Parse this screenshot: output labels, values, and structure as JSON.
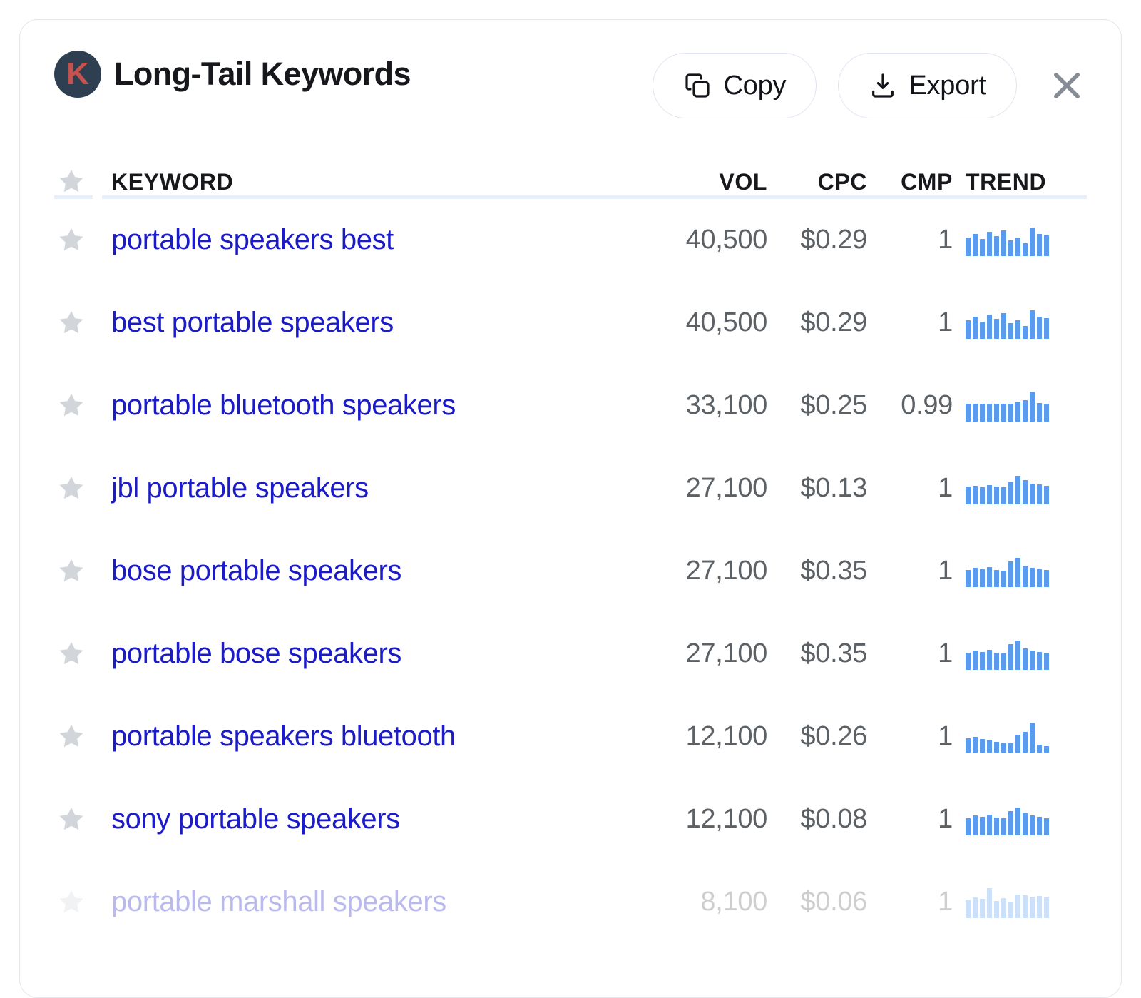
{
  "panel": {
    "title": "Long-Tail Keywords",
    "logo_letter": "K",
    "logo_bg_color": "#2D3F50",
    "logo_letter_color": "#C6514E",
    "border_color": "#E3E6EB"
  },
  "toolbar": {
    "copy_label": "Copy",
    "copy_icon": "copy-icon",
    "export_label": "Export",
    "export_icon": "download-icon",
    "close_icon": "close-icon"
  },
  "table": {
    "columns": {
      "star": "",
      "keyword": "KEYWORD",
      "vol": "VOL",
      "cpc": "CPC",
      "cmp": "CMP",
      "trend": "TREND"
    },
    "link_color": "#1B1BC8",
    "number_color": "#5C6166",
    "spark_color": "#5B9BEE",
    "star_color": "#D2D5DA",
    "rows": [
      {
        "keyword": "portable speakers best",
        "vol": "40,500",
        "cpc": "$0.29",
        "cmp": "1",
        "trend": [
          62,
          74,
          58,
          80,
          66,
          86,
          52,
          62,
          44,
          96,
          74,
          70
        ],
        "faded": false
      },
      {
        "keyword": "best portable speakers",
        "vol": "40,500",
        "cpc": "$0.29",
        "cmp": "1",
        "trend": [
          62,
          74,
          58,
          80,
          66,
          86,
          52,
          62,
          44,
          96,
          74,
          70
        ],
        "faded": false
      },
      {
        "keyword": "portable bluetooth speakers",
        "vol": "33,100",
        "cpc": "$0.25",
        "cmp": "0.99",
        "trend": [
          60,
          60,
          60,
          60,
          60,
          60,
          60,
          66,
          72,
          100,
          62,
          60
        ],
        "faded": false
      },
      {
        "keyword": "jbl portable speakers",
        "vol": "27,100",
        "cpc": "$0.13",
        "cmp": "1",
        "trend": [
          60,
          62,
          58,
          64,
          60,
          56,
          74,
          96,
          80,
          70,
          66,
          62
        ],
        "faded": false
      },
      {
        "keyword": "bose portable speakers",
        "vol": "27,100",
        "cpc": "$0.35",
        "cmp": "1",
        "trend": [
          58,
          64,
          60,
          66,
          58,
          54,
          86,
          98,
          72,
          64,
          60,
          56
        ],
        "faded": false
      },
      {
        "keyword": "portable bose speakers",
        "vol": "27,100",
        "cpc": "$0.35",
        "cmp": "1",
        "trend": [
          58,
          64,
          60,
          66,
          58,
          54,
          86,
          98,
          72,
          64,
          60,
          56
        ],
        "faded": false
      },
      {
        "keyword": "portable speakers bluetooth",
        "vol": "12,100",
        "cpc": "$0.26",
        "cmp": "1",
        "trend": [
          48,
          52,
          46,
          42,
          36,
          34,
          32,
          60,
          70,
          100,
          26,
          22
        ],
        "faded": false
      },
      {
        "keyword": "sony portable speakers",
        "vol": "12,100",
        "cpc": "$0.08",
        "cmp": "1",
        "trend": [
          58,
          66,
          62,
          70,
          60,
          56,
          80,
          94,
          74,
          66,
          62,
          58
        ],
        "faded": false
      },
      {
        "keyword": "portable marshall speakers",
        "vol": "8,100",
        "cpc": "$0.06",
        "cmp": "1",
        "trend": [
          62,
          70,
          64,
          100,
          58,
          66,
          54,
          78,
          76,
          72,
          74,
          70
        ],
        "faded": true
      }
    ]
  }
}
